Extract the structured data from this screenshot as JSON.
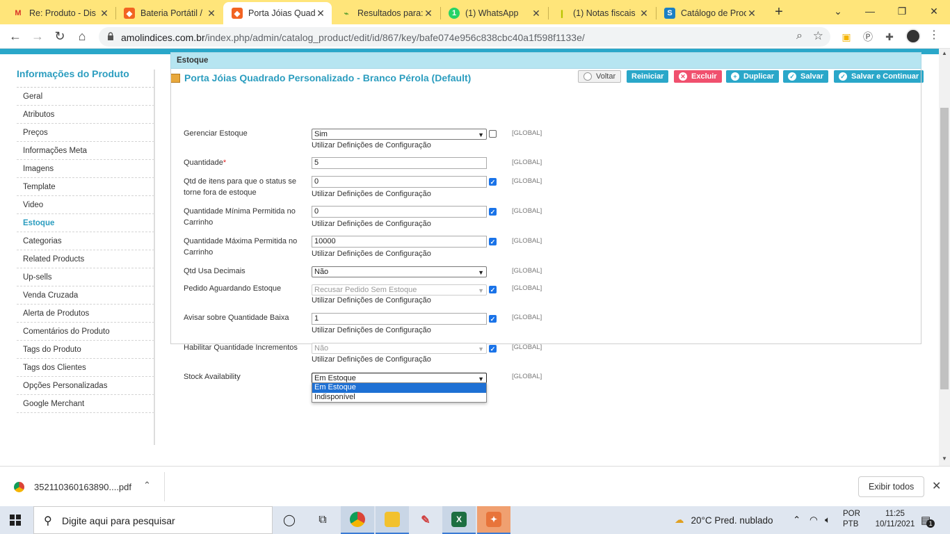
{
  "browser": {
    "tabs": [
      {
        "label": "Re: Produto - Dis",
        "icon": "gmail-icon"
      },
      {
        "label": "Bateria Portátil / ",
        "icon": "magento-icon"
      },
      {
        "label": "Porta Jóias Quad",
        "icon": "magento-icon",
        "active": true
      },
      {
        "label": "Resultados para:",
        "icon": "google-icon"
      },
      {
        "label": "(1) WhatsApp",
        "icon": "whatsapp-icon"
      },
      {
        "label": "(1) Notas fiscais",
        "icon": "tag-icon"
      },
      {
        "label": "Catálogo de Prod",
        "icon": "catalog-icon"
      }
    ],
    "new_tab": "+",
    "url_host": "amolindices.com.br",
    "url_path": "/index.php/admin/catalog_product/edit/id/867/key/bafe074e956c838cbc40a1f598f1133e/"
  },
  "sidebar": {
    "title": "Informações do Produto",
    "items": [
      {
        "label": "Geral"
      },
      {
        "label": "Atributos"
      },
      {
        "label": "Preços"
      },
      {
        "label": "Informações Meta"
      },
      {
        "label": "Imagens"
      },
      {
        "label": "Template"
      },
      {
        "label": "Video"
      },
      {
        "label": "Estoque",
        "active": true
      },
      {
        "label": "Categorias"
      },
      {
        "label": "Related Products"
      },
      {
        "label": "Up-sells"
      },
      {
        "label": "Venda Cruzada"
      },
      {
        "label": "Alerta de Produtos"
      },
      {
        "label": "Comentários do Produto"
      },
      {
        "label": "Tags do Produto"
      },
      {
        "label": "Tags dos Clientes"
      },
      {
        "label": "Opções Personalizadas"
      },
      {
        "label": "Google Merchant"
      }
    ]
  },
  "header": {
    "title": "Porta Jóias Quadrado Personalizado - Branco Pérola (Default)",
    "buttons": {
      "voltar": "Voltar",
      "reiniciar": "Reiniciar",
      "excluir": "Excluir",
      "duplicar": "Duplicar",
      "salvar": "Salvar",
      "salvar_continuar": "Salvar e Continuar"
    }
  },
  "stock": {
    "section_title": "Estoque",
    "scope": "[GLOBAL]",
    "use_config": "Utilizar Definições de Configuração",
    "gerenciar_estoque": {
      "label": "Gerenciar Estoque",
      "value": "Sim",
      "use_config": false
    },
    "quantidade": {
      "label": "Quantidade",
      "required_mark": "*",
      "value": "5"
    },
    "qtd_fora_estoque": {
      "label": "Qtd de itens para que o status se torne fora de estoque",
      "value": "0",
      "use_config": true
    },
    "qtd_min_carrinho": {
      "label": "Quantidade Mínima Permitida no Carrinho",
      "value": "0",
      "use_config": true
    },
    "qtd_max_carrinho": {
      "label": "Quantidade Máxima Permitida no Carrinho",
      "value": "10000",
      "use_config": true
    },
    "qtd_usa_decimais": {
      "label": "Qtd Usa Decimais",
      "value": "Não"
    },
    "pedido_aguardando": {
      "label": "Pedido Aguardando Estoque",
      "value": "Recusar Pedido Sem Estoque",
      "use_config": true
    },
    "avisar_qtd_baixa": {
      "label": "Avisar sobre Quantidade Baixa",
      "value": "1",
      "use_config": true
    },
    "habilitar_incrementos": {
      "label": "Habilitar Quantidade Incrementos",
      "value": "Não",
      "use_config": true
    },
    "stock_availability": {
      "label": "Stock Availability",
      "value": "Em Estoque",
      "options": [
        "Em Estoque",
        "Indisponível"
      ]
    }
  },
  "downloads": {
    "file": "352110360163890....pdf",
    "show_all": "Exibir todos"
  },
  "taskbar": {
    "search_placeholder": "Digite aqui para pesquisar",
    "weather": "20°C  Pred. nublado",
    "lang_top": "POR",
    "lang_bottom": "PTB",
    "time": "11:25",
    "date": "10/11/2021",
    "notif_count": "1"
  }
}
